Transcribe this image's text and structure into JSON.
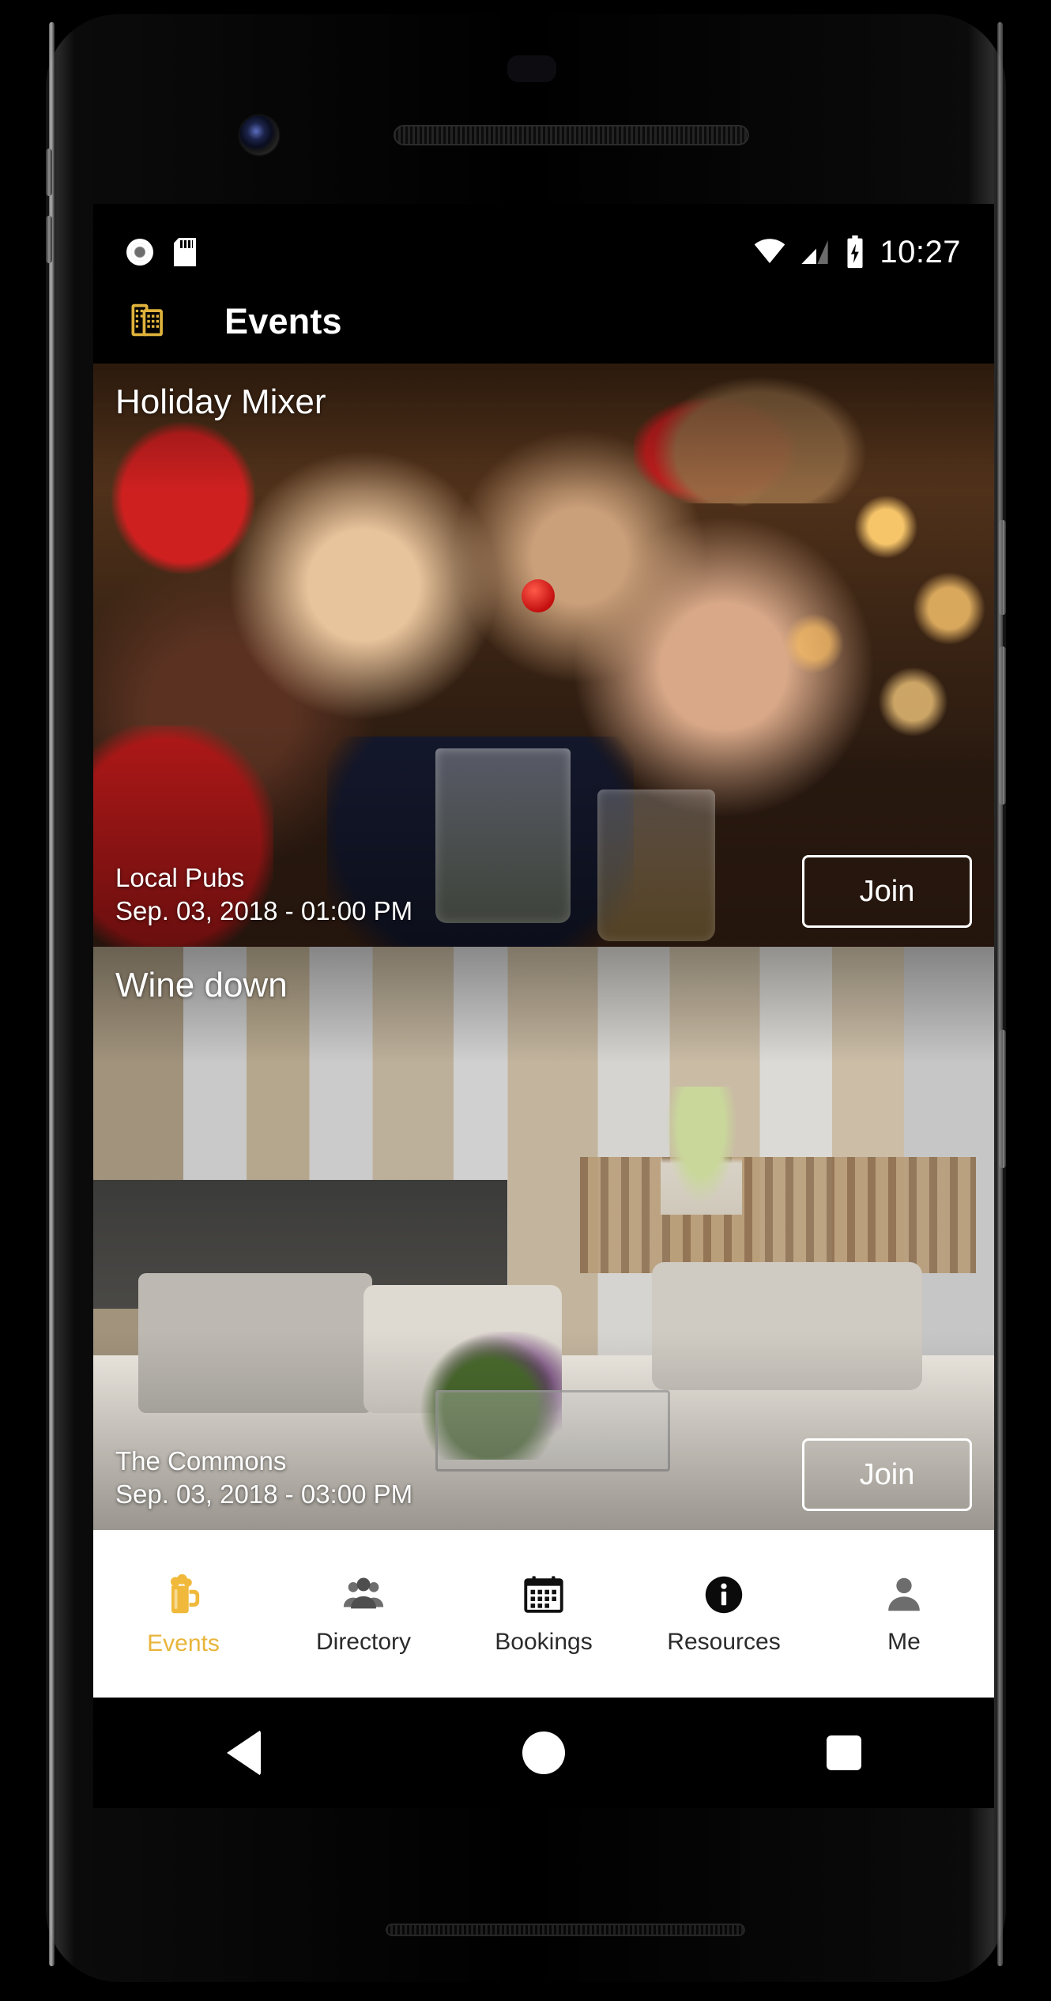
{
  "device": {
    "kind": "android-phone"
  },
  "status_bar": {
    "left_icons": [
      "screen-cast-icon",
      "sd-card-icon"
    ],
    "right_icons": [
      "wifi-icon",
      "cell-signal-icon",
      "battery-charging-icon"
    ],
    "time": "10:27"
  },
  "app_bar": {
    "icon": "buildings-icon",
    "title": "Events",
    "icon_color": "#e0b33c"
  },
  "events": [
    {
      "title": "Holiday Mixer",
      "venue": "Local Pubs",
      "datetime": "Sep. 03, 2018 - 01:00 PM",
      "action_label": "Join",
      "image": "holiday-party-photo"
    },
    {
      "title": "Wine down",
      "venue": "The Commons",
      "datetime": "Sep. 03, 2018 - 03:00 PM",
      "action_label": "Join",
      "image": "lounge-interior-photo"
    }
  ],
  "tab_bar": {
    "active_color": "#e8b53b",
    "inactive_color": "#2b2b2b",
    "items": [
      {
        "label": "Events",
        "icon": "beer-mug-icon",
        "active": true
      },
      {
        "label": "Directory",
        "icon": "people-icon",
        "active": false
      },
      {
        "label": "Bookings",
        "icon": "calendar-icon",
        "active": false
      },
      {
        "label": "Resources",
        "icon": "info-circle-icon",
        "active": false
      },
      {
        "label": "Me",
        "icon": "person-icon",
        "active": false
      }
    ]
  },
  "android_nav": {
    "items": [
      {
        "label": "Back",
        "icon": "triangle-back-icon"
      },
      {
        "label": "Home",
        "icon": "circle-home-icon"
      },
      {
        "label": "Recents",
        "icon": "square-recents-icon"
      }
    ]
  }
}
